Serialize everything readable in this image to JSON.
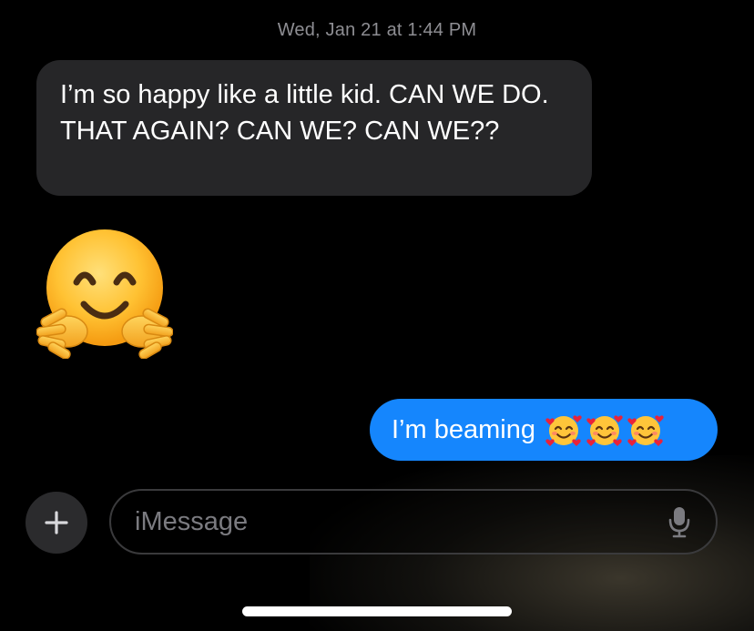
{
  "conversation": {
    "timestamp": "Wed, Jan 21 at 1:44 PM",
    "incoming_message": "I’m so happy like a little kid.  CAN WE DO. THAT AGAIN?  CAN WE?  CAN WE??",
    "incoming_emoji": "hugging-face-emoji",
    "outgoing_message": "I’m beaming",
    "outgoing_emoji": [
      "smiling-face-with-hearts",
      "smiling-face-with-hearts",
      "smiling-face-with-hearts"
    ]
  },
  "composer": {
    "plus_icon": "plus-icon",
    "placeholder": "iMessage",
    "mic_icon": "microphone-icon"
  },
  "colors": {
    "background": "#000000",
    "incoming_bubble": "#262628",
    "outgoing_bubble": "#1586fd",
    "timestamp_text": "#8e8e93",
    "placeholder_text": "#7b7b80"
  }
}
